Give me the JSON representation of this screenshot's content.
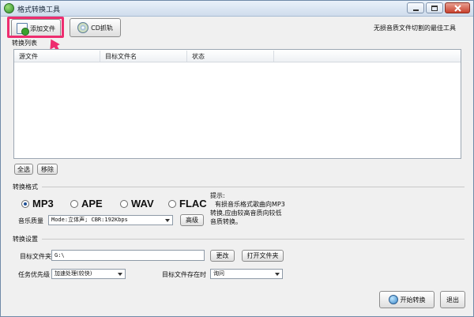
{
  "window": {
    "title": "格式转换工具"
  },
  "toolbar": {
    "add_file_label": "添加文件",
    "cd_rip_label": "CD抓轨",
    "slogan": "无损音质文件切割的最佳工具"
  },
  "file_list": {
    "section_label": "转换列表",
    "columns": [
      "源文件",
      "目标文件名",
      "状态"
    ],
    "rows": [],
    "select_all_label": "全选",
    "remove_label": "移除"
  },
  "format": {
    "section_label": "转换格式",
    "options": [
      "MP3",
      "APE",
      "WAV",
      "FLAC"
    ],
    "selected": "MP3",
    "quality_label": "音乐质量",
    "quality_value": "Mode:立体声; CBR:192Kbps",
    "advanced_label": "高级",
    "hint_lines": [
      "提示:",
      "有损音乐格式歌曲向MP3",
      "转换,应由较高音质向较低",
      "音质转换。"
    ]
  },
  "settings": {
    "section_label": "转换设置",
    "target_folder_label": "目标文件夹",
    "target_folder_value": "G:\\",
    "change_label": "更改",
    "open_folder_label": "打开文件夹",
    "priority_label": "任务优先级",
    "priority_value": "加速处理(较快)",
    "exists_label": "目标文件存在时",
    "exists_value": "询问"
  },
  "actions": {
    "convert_label": "开始转换",
    "exit_label": "退出"
  },
  "colors": {
    "highlight": "#ee2d6f"
  }
}
